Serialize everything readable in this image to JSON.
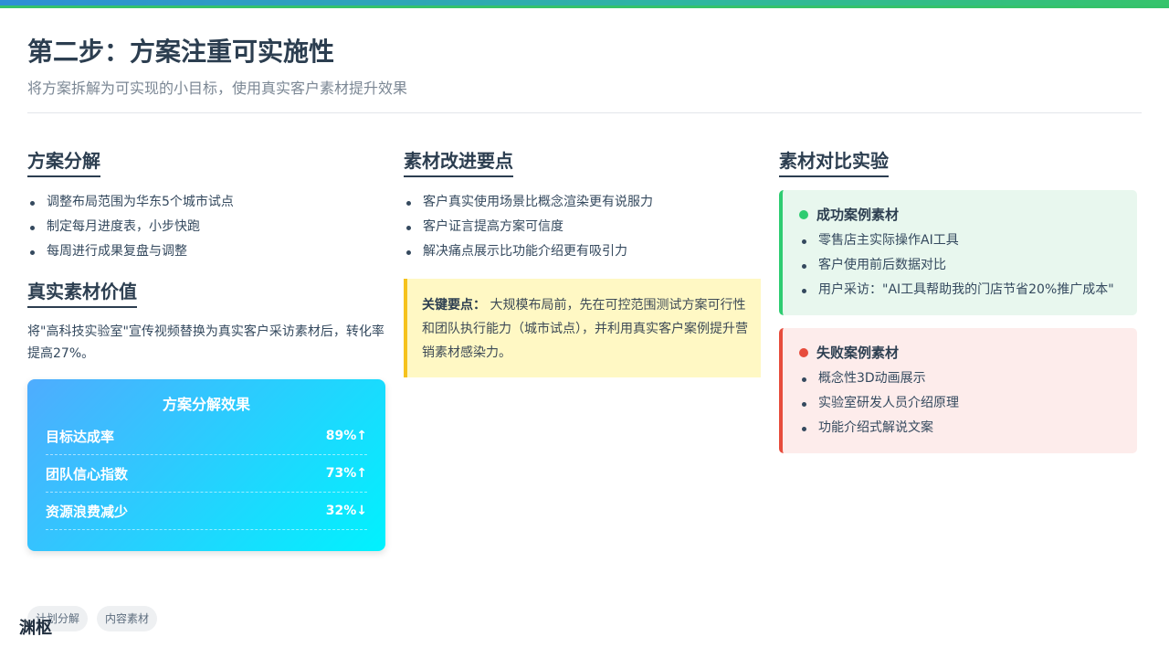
{
  "header": {
    "title": "第二步：方案注重可实施性",
    "subtitle": "将方案拆解为可实现的小目标，使用真实客户素材提升效果"
  },
  "plan": {
    "title": "方案分解",
    "items": [
      "调整布局范围为华东5个城市试点",
      "制定每月进度表，小步快跑",
      "每周进行成果复盘与调整"
    ]
  },
  "value": {
    "title": "真实素材价值",
    "text": "将\"高科技实验室\"宣传视频替换为真实客户采访素材后，转化率提高27%。"
  },
  "effect": {
    "title": "方案分解效果",
    "rows": [
      {
        "label": "目标达成率",
        "value": "89%↑"
      },
      {
        "label": "团队信心指数",
        "value": "73%↑"
      },
      {
        "label": "资源浪费减少",
        "value": "32%↓"
      }
    ]
  },
  "improve": {
    "title": "素材改进要点",
    "items": [
      "客户真实使用场景比概念渲染更有说服力",
      "客户证言提高方案可信度",
      "解决痛点展示比功能介绍更有吸引力"
    ]
  },
  "note": {
    "label": "关键要点：",
    "text": "大规模布局前，先在可控范围测试方案可行性和团队执行能力（城市试点），并利用真实客户案例提升营销素材感染力。"
  },
  "compare": {
    "title": "素材对比实验",
    "good": {
      "title": "成功案例素材",
      "color": "#2ecc71",
      "items": [
        "零售店主实际操作AI工具",
        "客户使用前后数据对比",
        "用户采访：\"AI工具帮助我的门店节省20%推广成本\""
      ]
    },
    "bad": {
      "title": "失败案例素材",
      "color": "#e74c3c",
      "items": [
        "概念性3D动画展示",
        "实验室研发人员介绍原理",
        "功能介绍式解说文案"
      ]
    }
  },
  "tags": [
    "计划分解",
    "内容素材"
  ],
  "brand": "渊枢",
  "colors": {
    "accent_blue": "#4facfe",
    "accent_cyan": "#00f2fe",
    "note_border": "#f6c21c"
  }
}
